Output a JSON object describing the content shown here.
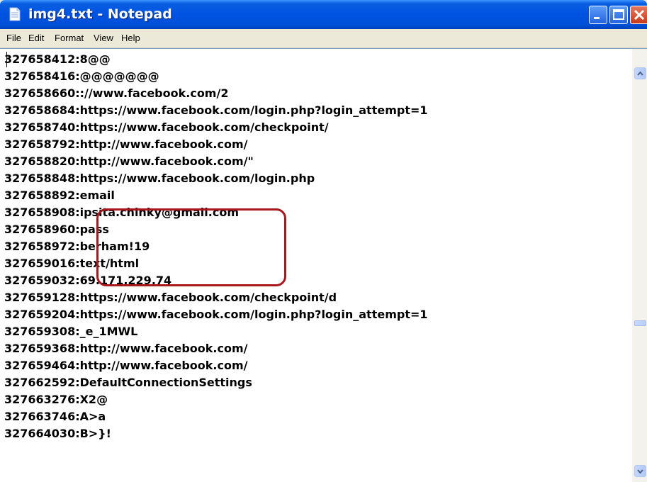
{
  "window": {
    "title": "img4.txt - Notepad",
    "colors": {
      "titlebar": "#0053e1",
      "highlight": "#a8171d"
    }
  },
  "menu": [
    "File",
    "Edit",
    "Format",
    "View",
    "Help"
  ],
  "document": {
    "lines": [
      "327658412:8@@",
      "327658416:@@@@@@@",
      "327658660:://www.facebook.com/2",
      "327658684:https://www.facebook.com/login.php?login_attempt=1",
      "327658740:https://www.facebook.com/checkpoint/",
      "327658792:http://www.facebook.com/",
      "327658820:http://www.facebook.com/\"",
      "327658848:https://www.facebook.com/login.php",
      "327658892:email",
      "327658908:ipsita.chinky@gmail.com",
      "327658960:pass",
      "327658972:berham!19",
      "327659016:text/html",
      "327659032:69.171.229.74",
      "327659128:https://www.facebook.com/checkpoint/d",
      "327659204:https://www.facebook.com/login.php?login_attempt=1",
      "327659308:_e_1MWL",
      "327659368:http://www.facebook.com/",
      "327659464:http://www.facebook.com/",
      "327662592:DefaultConnectionSettings",
      "327663276:X2@",
      "327663746:A>a",
      "327664030:B>}!"
    ]
  }
}
